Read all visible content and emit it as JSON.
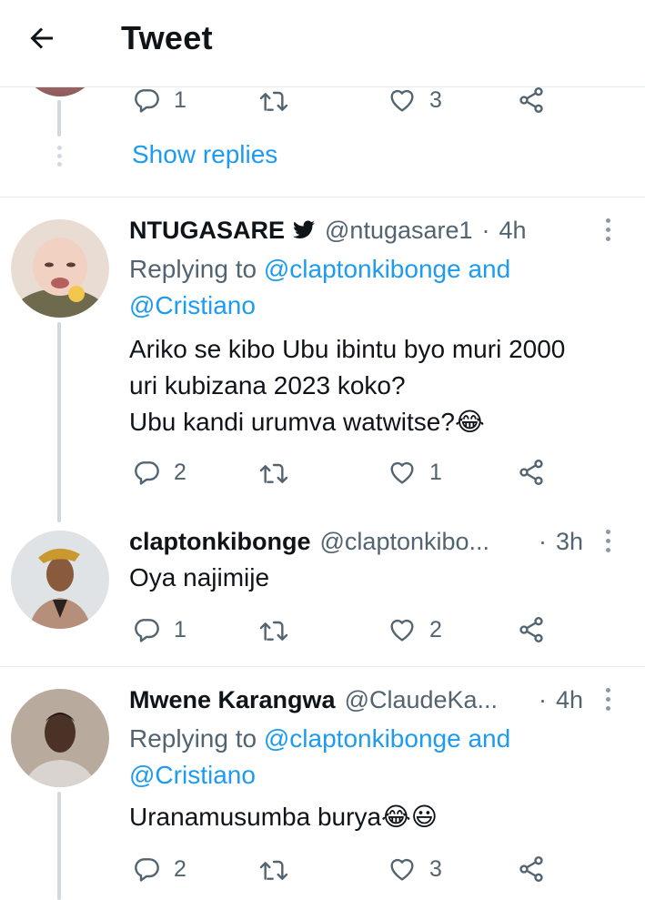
{
  "header": {
    "title": "Tweet"
  },
  "top_tweet": {
    "actions": {
      "replies": "1",
      "likes": "3"
    },
    "show_replies": "Show replies"
  },
  "tweets": [
    {
      "name": "NTUGASARE",
      "verified_icon": "twitter-bird-icon",
      "handle": "@ntugasare1",
      "sep": "·",
      "time": "4h",
      "replying_prefix": "Replying to",
      "mention_1": "@claptonkibonge",
      "and": "and",
      "mention_2": "@Cristiano",
      "text_lines": [
        "Ariko se kibo Ubu ibintu byo muri 2000",
        "uri kubizana 2023 koko?",
        "Ubu kandi urumva watwitse?😂"
      ],
      "replies": "2",
      "likes": "1"
    },
    {
      "name": "claptonkibonge",
      "handle": "@claptonkibo...",
      "sep": "·",
      "time": "3h",
      "text_lines": [
        "Oya najimije"
      ],
      "replies": "1",
      "likes": "2"
    },
    {
      "name": "Mwene Karangwa",
      "handle": "@ClaudeKa...",
      "sep": "·",
      "time": "4h",
      "replying_prefix": "Replying to",
      "mention_1": "@claptonkibonge",
      "and": "and",
      "mention_2": "@Cristiano",
      "text_lines": [
        "Uranamusumba burya😂😃"
      ],
      "replies": "2",
      "likes": "3"
    }
  ],
  "colors": {
    "accent": "#1d9bf0",
    "muted": "#536471",
    "line": "#cfd9de"
  }
}
